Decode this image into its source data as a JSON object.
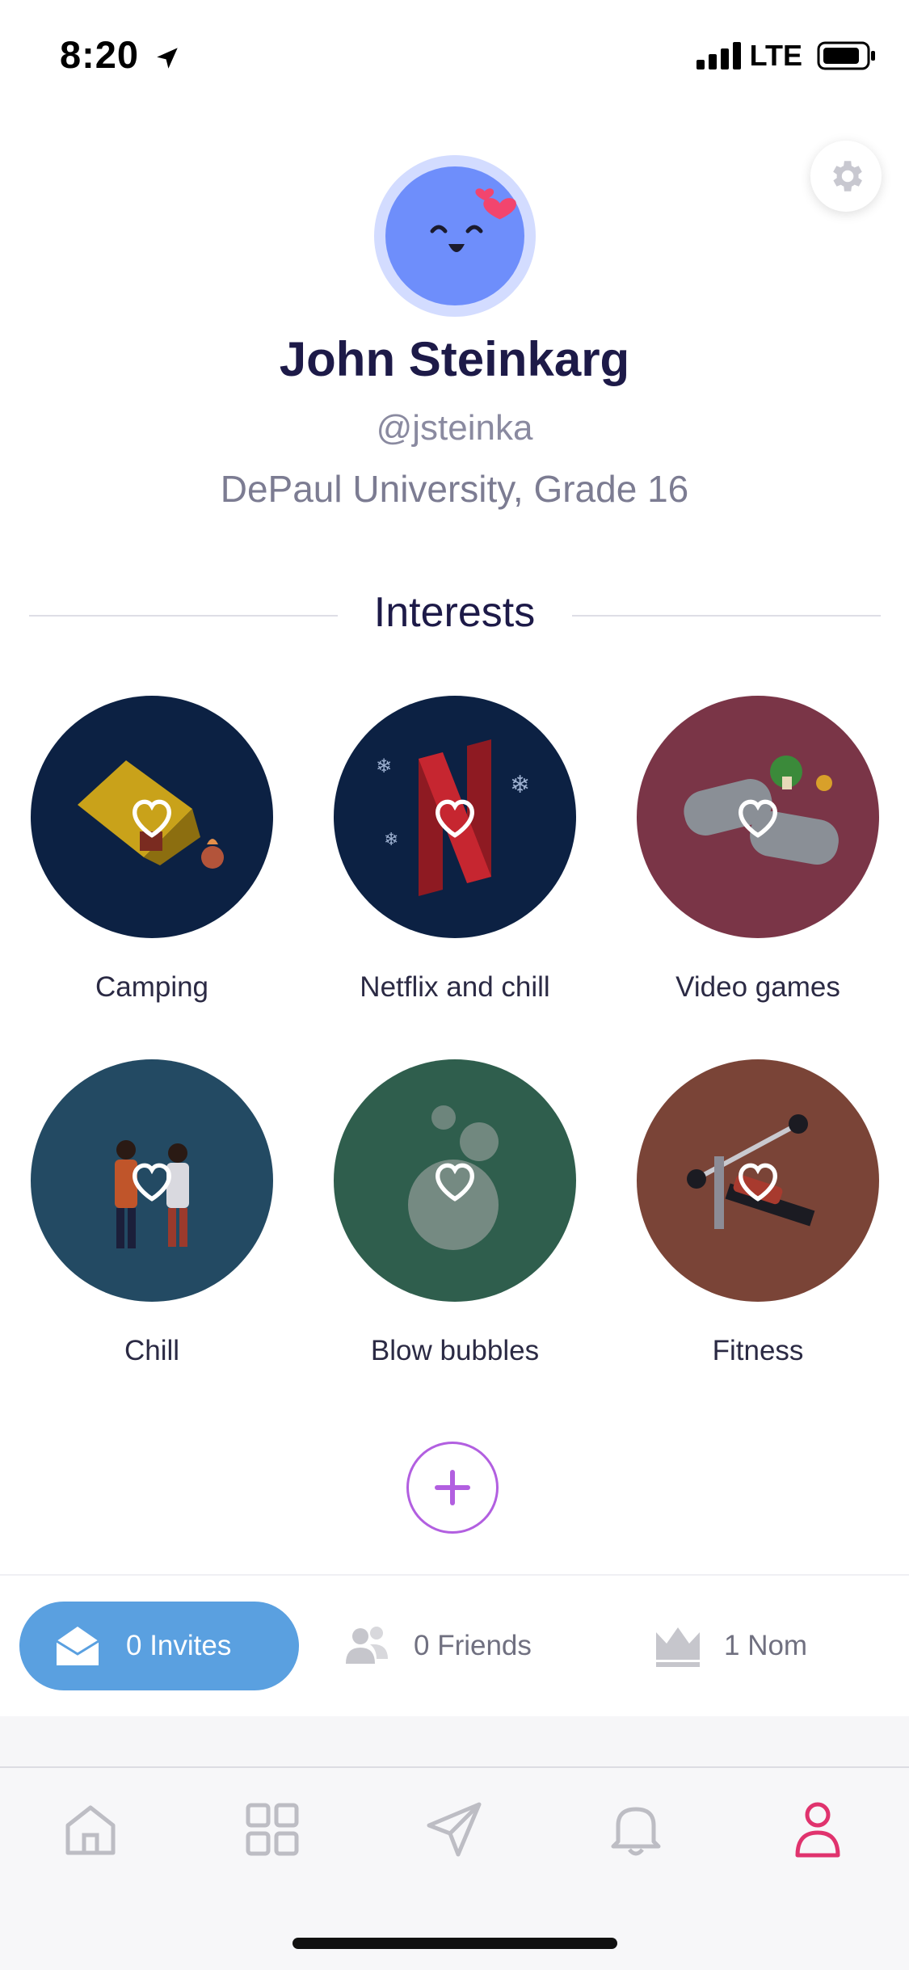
{
  "status_bar": {
    "time": "8:20",
    "network": "LTE"
  },
  "profile": {
    "name": "John Steinkarg",
    "handle": "@jsteinka",
    "school": "DePaul University, Grade 16"
  },
  "interests": {
    "title": "Interests",
    "items": [
      {
        "label": "Camping",
        "color": "#0c2143"
      },
      {
        "label": "Netflix and chill",
        "color": "#0c2143"
      },
      {
        "label": "Video games",
        "color": "#7a3547"
      },
      {
        "label": "Chill",
        "color": "#234a63"
      },
      {
        "label": "Blow bubbles",
        "color": "#2f5e4d"
      },
      {
        "label": "Fitness",
        "color": "#7a4437"
      }
    ]
  },
  "stats": {
    "invites": "0 Invites",
    "friends": "0 Friends",
    "noms": "1 Nom"
  },
  "colors": {
    "accent": "#b25fe0",
    "invites_pill": "#5aa0e0",
    "active_tab": "#e0336e"
  },
  "tabs": [
    {
      "icon": "home-icon",
      "active": false
    },
    {
      "icon": "grid-icon",
      "active": false
    },
    {
      "icon": "send-icon",
      "active": false
    },
    {
      "icon": "bell-icon",
      "active": false
    },
    {
      "icon": "profile-icon",
      "active": true
    }
  ]
}
